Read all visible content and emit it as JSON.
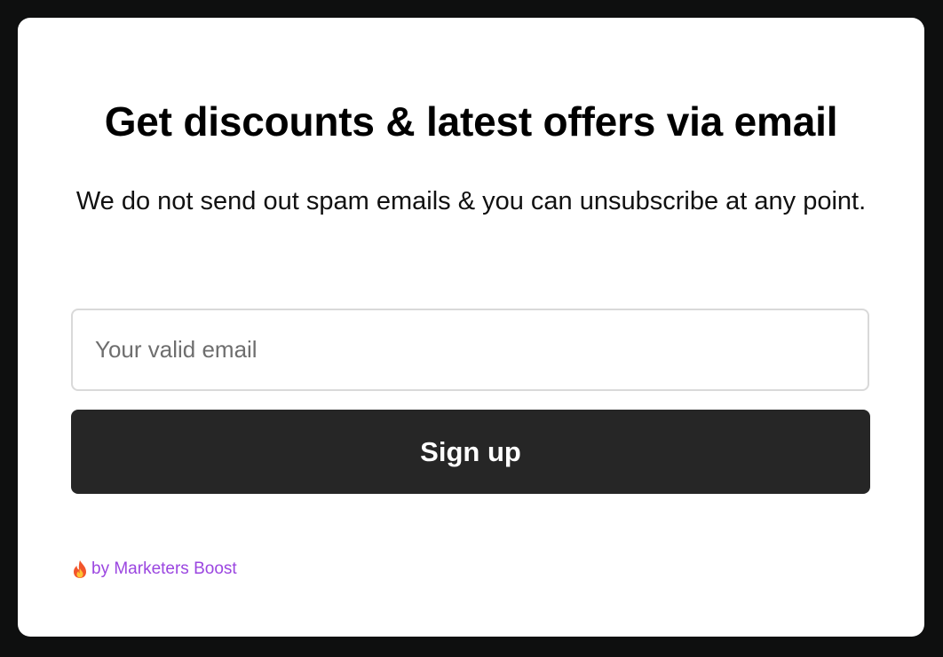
{
  "form": {
    "title": "Get discounts & latest offers via email",
    "subtitle": "We do not send out spam emails & you can unsubscribe at any point.",
    "email": {
      "placeholder": "Your valid email",
      "value": ""
    },
    "signup_label": "Sign up"
  },
  "credit": {
    "icon": "fire-icon",
    "text": "by Marketers Boost"
  },
  "colors": {
    "page_background": "#0e0f0f",
    "card_background": "#ffffff",
    "button_background": "#262626",
    "link_color": "#9b46e0"
  }
}
